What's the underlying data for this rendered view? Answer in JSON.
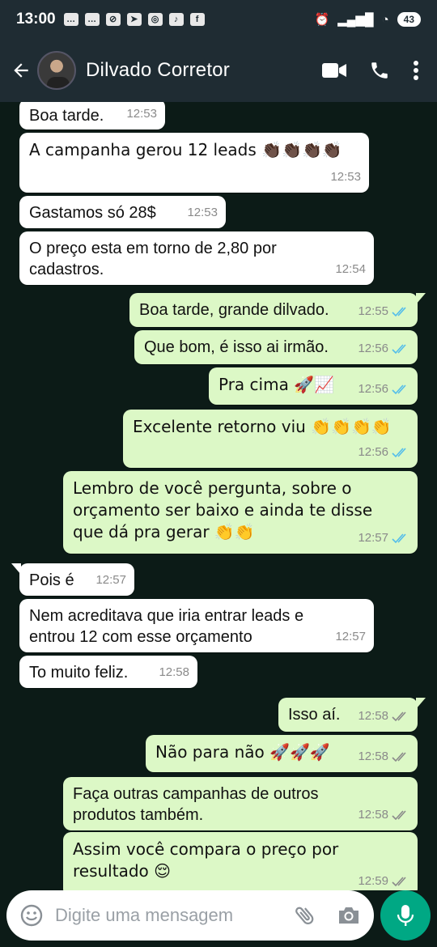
{
  "status": {
    "time": "13:00",
    "battery": "43"
  },
  "header": {
    "title": "Dilvado Corretor"
  },
  "messages": [
    {
      "dir": "in",
      "text": "Boa tarde.",
      "time": "12:53"
    },
    {
      "dir": "in",
      "text": "A campanha gerou 12 leads 👏🏿👏🏿👏🏿👏🏿",
      "time": "12:53"
    },
    {
      "dir": "in",
      "text": "Gastamos só 28$",
      "time": "12:53"
    },
    {
      "dir": "in",
      "text": "O preço esta em torno de  2,80 por cadastros.",
      "time": "12:54"
    },
    {
      "dir": "out",
      "text": "Boa tarde, grande dilvado.",
      "time": "12:55",
      "read": true
    },
    {
      "dir": "out",
      "text": "Que bom, é isso ai irmão.",
      "time": "12:56",
      "read": true
    },
    {
      "dir": "out",
      "text": "Pra cima 🚀📈",
      "time": "12:56",
      "read": true
    },
    {
      "dir": "out",
      "text": "Excelente retorno viu 👏👏👏👏",
      "time": "12:56",
      "read": true
    },
    {
      "dir": "out",
      "text": "Lembro de você pergunta, sobre o orçamento ser baixo e ainda te disse que dá pra gerar 👏👏",
      "time": "12:57",
      "read": true
    },
    {
      "dir": "in",
      "text": "Pois é",
      "time": "12:57"
    },
    {
      "dir": "in",
      "text": "Nem acreditava que iria entrar leads e entrou 12 com esse orçamento",
      "time": "12:57"
    },
    {
      "dir": "in",
      "text": "To muito feliz.",
      "time": "12:58"
    },
    {
      "dir": "out",
      "text": "Isso aí.",
      "time": "12:58",
      "read": false
    },
    {
      "dir": "out",
      "text": "Não para não 🚀🚀🚀",
      "time": "12:58",
      "read": false
    },
    {
      "dir": "out",
      "text": "Faça outras campanhas de outros produtos também.",
      "time": "12:58",
      "read": false
    },
    {
      "dir": "out",
      "text": "Assim você compara o preço por resultado 😌",
      "time": "12:59",
      "read": false
    }
  ],
  "composer": {
    "placeholder": "Digite uma mensagem"
  },
  "colors": {
    "read_tick": "#53bdeb",
    "sent_tick": "#8a8a8a",
    "accent": "#00a884"
  }
}
